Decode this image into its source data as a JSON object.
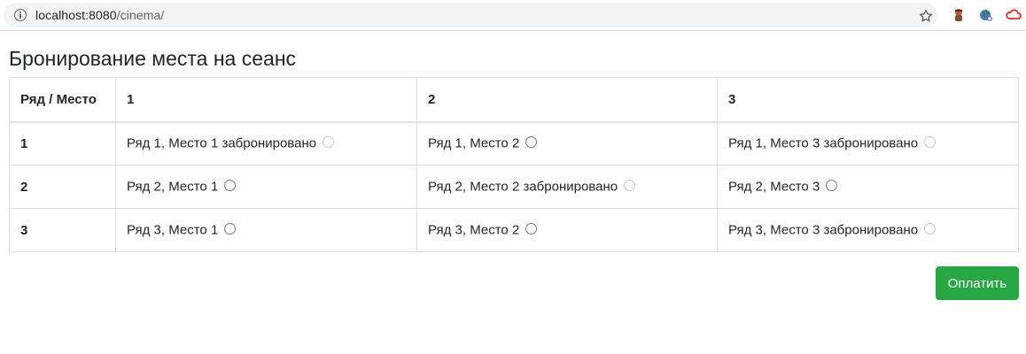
{
  "browser": {
    "url_host": "localhost:8080",
    "url_path": "/cinema/"
  },
  "page": {
    "title": "Бронирование места на сеанс"
  },
  "table": {
    "corner_header": "Ряд / Место",
    "columns": [
      "1",
      "2",
      "3"
    ],
    "rows": [
      {
        "label": "1",
        "cells": [
          {
            "text": "Ряд 1, Место 1 забронировано",
            "booked": true
          },
          {
            "text": "Ряд 1, Место 2",
            "booked": false
          },
          {
            "text": "Ряд 1, Место 3 забронировано",
            "booked": true
          }
        ]
      },
      {
        "label": "2",
        "cells": [
          {
            "text": "Ряд 2, Место 1",
            "booked": false
          },
          {
            "text": "Ряд 2, Место 2 забронировано",
            "booked": true
          },
          {
            "text": "Ряд 2, Место 3",
            "booked": false
          }
        ]
      },
      {
        "label": "3",
        "cells": [
          {
            "text": "Ряд 3, Место 1",
            "booked": false
          },
          {
            "text": "Ряд 3, Место 2",
            "booked": false
          },
          {
            "text": "Ряд 3, Место 3 забронировано",
            "booked": true
          }
        ]
      }
    ]
  },
  "actions": {
    "pay_label": "Оплатить"
  },
  "colors": {
    "pay_button": "#28a745",
    "table_border": "#dee2e6"
  }
}
